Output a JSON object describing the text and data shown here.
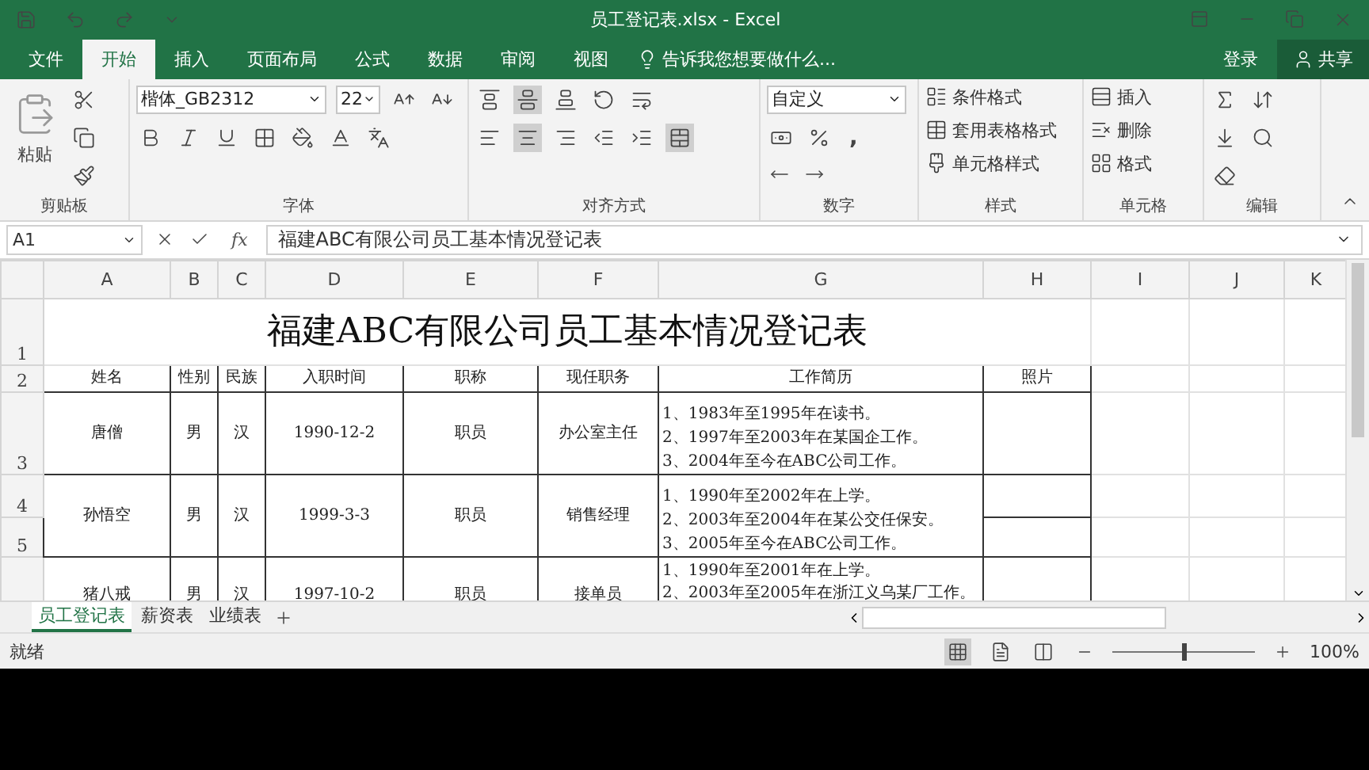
{
  "window": {
    "title": "员工登记表.xlsx - Excel"
  },
  "ribbon_tabs": [
    {
      "label": "文件",
      "selected": false
    },
    {
      "label": "开始",
      "selected": true
    },
    {
      "label": "插入",
      "selected": false
    },
    {
      "label": "页面布局",
      "selected": false
    },
    {
      "label": "公式",
      "selected": false
    },
    {
      "label": "数据",
      "selected": false
    },
    {
      "label": "审阅",
      "selected": false
    },
    {
      "label": "视图",
      "selected": false
    }
  ],
  "tell_me": "告诉我您想要做什么...",
  "account": {
    "sign_in": "登录",
    "share": "共享"
  },
  "ribbon": {
    "clipboard": {
      "paste": "粘贴",
      "label": "剪贴板"
    },
    "font": {
      "name": "楷体_GB2312",
      "size": "22",
      "label": "字体"
    },
    "alignment": {
      "label": "对齐方式"
    },
    "number": {
      "format": "自定义",
      "comma": ",",
      "label": "数字"
    },
    "styles": {
      "items": [
        "条件格式",
        "套用表格格式",
        "单元格样式"
      ],
      "label": "样式"
    },
    "cells": {
      "items": [
        "插入",
        "删除",
        "格式"
      ],
      "label": "单元格"
    },
    "editing": {
      "label": "编辑"
    }
  },
  "formula_bar": {
    "name_box": "A1",
    "function_button": "fx",
    "formula": "福建ABC有限公司员工基本情况登记表"
  },
  "sheet": {
    "columns": [
      "A",
      "B",
      "C",
      "D",
      "E",
      "F",
      "G",
      "H",
      "I",
      "J",
      "K"
    ],
    "title_row": "1",
    "header_row": "2",
    "title": "福建ABC有限公司员工基本情况登记表",
    "headers": [
      "姓名",
      "性别",
      "民族",
      "入职时间",
      "职称",
      "现任职务",
      "工作简历",
      "照片"
    ],
    "records": [
      {
        "row_numbers": [
          "3"
        ],
        "cells": [
          "唐僧",
          "男",
          "汉",
          "1990-12-2",
          "职员",
          "办公室主任"
        ],
        "resume": [
          "1、1983年至1995年在读书。",
          "2、1997年至2003年在某国企工作。",
          "3、2004年至今在ABC公司工作。"
        ]
      },
      {
        "row_numbers": [
          "4",
          "5"
        ],
        "cells": [
          "孙悟空",
          "男",
          "汉",
          "1999-3-3",
          "职员",
          "销售经理"
        ],
        "resume": [
          "1、1990年至2002年在上学。",
          "2、2003年至2004年在某公交任保安。",
          "3、2005年至今在ABC公司工作。"
        ]
      },
      {
        "cells": [
          "猪八戒",
          "男",
          "汉",
          "1997-10-2",
          "职员",
          "接单员"
        ],
        "resume": [
          "1、1990年至2001年在上学。",
          "2、2003年至2005年在浙江义乌某厂工作。"
        ]
      }
    ]
  },
  "sheet_tabs": [
    {
      "label": "员工登记表",
      "selected": true
    },
    {
      "label": "薪资表",
      "selected": false
    },
    {
      "label": "业绩表",
      "selected": false
    }
  ],
  "status_bar": {
    "status": "就绪",
    "zoom": "100%",
    "zoom_slider": {
      "level": 0.5
    }
  }
}
